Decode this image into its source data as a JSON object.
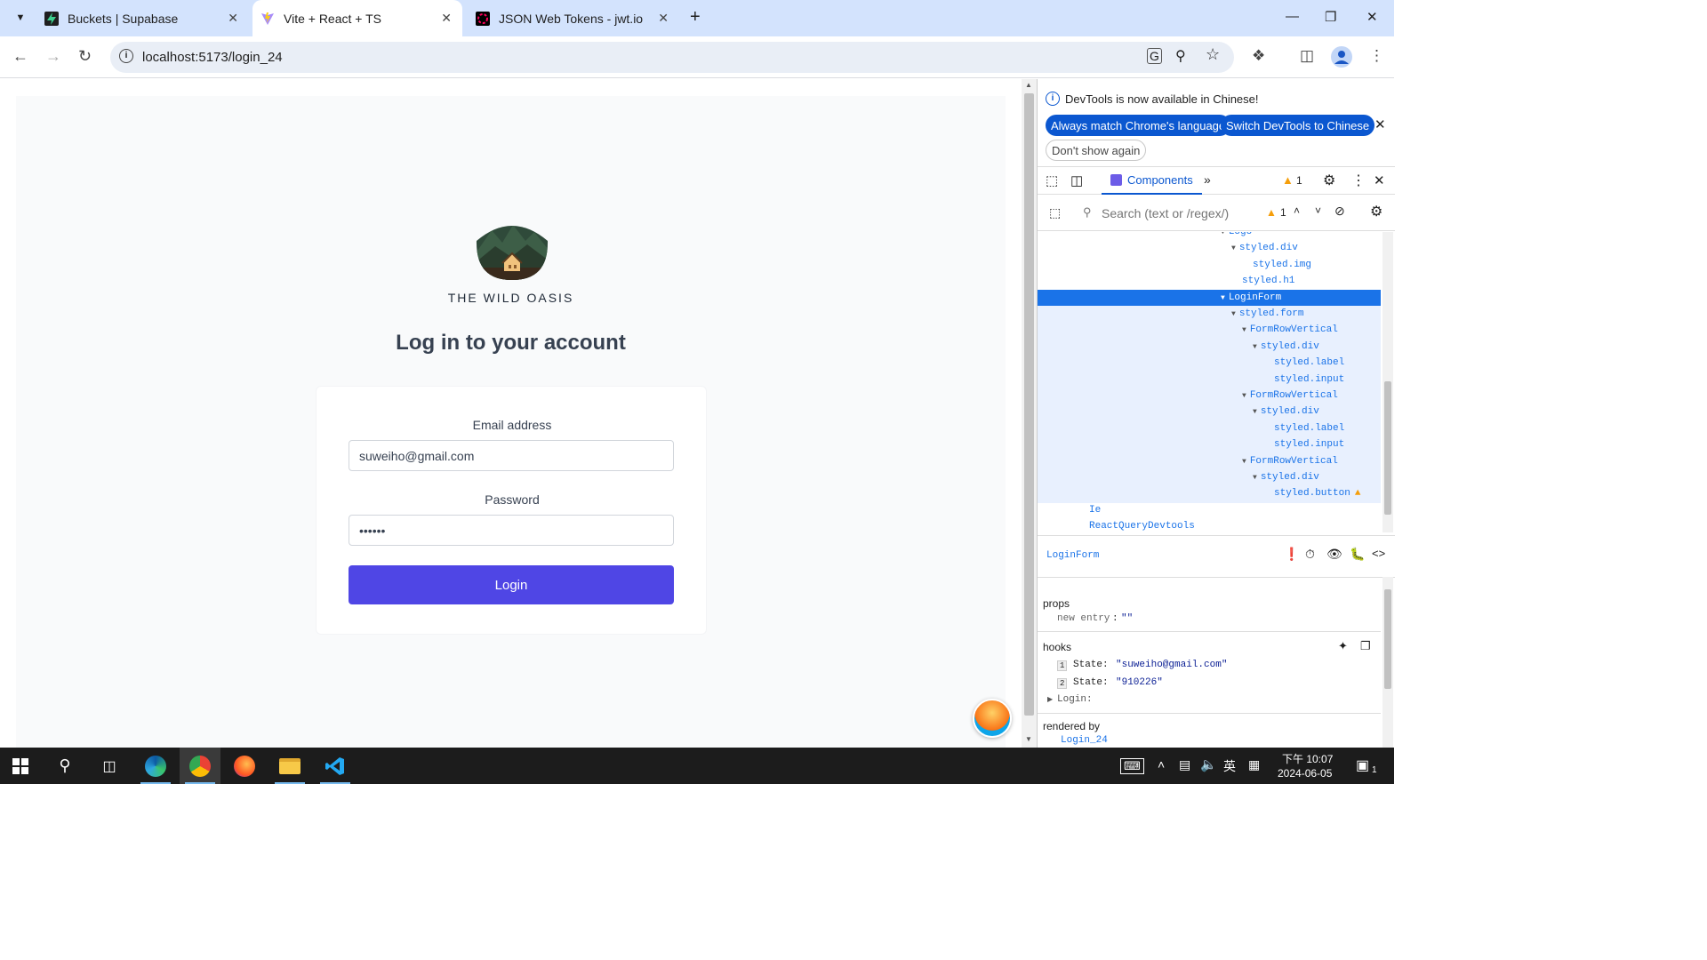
{
  "tabs": [
    {
      "title": "Buckets | Supabase",
      "favicon_color": "#3ecf8e"
    },
    {
      "title": "Vite + React + TS",
      "favicon_color": "#9f6aff"
    },
    {
      "title": "JSON Web Tokens - jwt.io",
      "favicon_color": "#d63aff"
    }
  ],
  "address": {
    "url": "localhost:5173/login_24"
  },
  "app": {
    "brand": "THE WILD OASIS",
    "heading": "Log in to your account",
    "email_label": "Email address",
    "email_value": "suweiho@gmail.com",
    "password_label": "Password",
    "password_value": "910226",
    "login_label": "Login"
  },
  "devtools": {
    "info": "DevTools is now available in Chinese!",
    "btn_match": "Always match Chrome's language",
    "btn_switch": "Switch DevTools to Chinese",
    "btn_dont": "Don't show again",
    "tab_components": "Components",
    "warn_count": "1",
    "search_placeholder": "Search (text or /regex/)",
    "search_warn_count": "1",
    "tree": [
      {
        "label": "Logo",
        "depth": 0,
        "arrow": true
      },
      {
        "label": "styled.div",
        "depth": 1,
        "arrow": true
      },
      {
        "label": "styled.img",
        "depth": 2,
        "arrow": false
      },
      {
        "label": "styled.h1",
        "depth": 1,
        "arrow": false
      },
      {
        "label": "LoginForm",
        "depth": 0,
        "arrow": true,
        "selected": true
      },
      {
        "label": "styled.form",
        "depth": 1,
        "arrow": true
      },
      {
        "label": "FormRowVertical",
        "depth": 2,
        "arrow": true
      },
      {
        "label": "styled.div",
        "depth": 3,
        "arrow": true
      },
      {
        "label": "styled.label",
        "depth": 4,
        "arrow": false
      },
      {
        "label": "styled.input",
        "depth": 4,
        "arrow": false
      },
      {
        "label": "FormRowVertical",
        "depth": 2,
        "arrow": true
      },
      {
        "label": "styled.div",
        "depth": 3,
        "arrow": true
      },
      {
        "label": "styled.label",
        "depth": 4,
        "arrow": false
      },
      {
        "label": "styled.input",
        "depth": 4,
        "arrow": false
      },
      {
        "label": "FormRowVertical",
        "depth": 2,
        "arrow": true
      },
      {
        "label": "styled.div",
        "depth": 3,
        "arrow": true
      },
      {
        "label": "styled.button",
        "depth": 4,
        "arrow": false,
        "warn": true
      },
      {
        "label": "Ie",
        "depth": -3,
        "arrow": false
      },
      {
        "label": "ReactQueryDevtools",
        "depth": -3,
        "arrow": false
      }
    ],
    "selected_component": "LoginForm",
    "props_title": "props",
    "props_new_entry": "new entry",
    "props_new_value": "\"\"",
    "hooks_title": "hooks",
    "hook1_index": "1",
    "hook1_label": "State:",
    "hook1_value": "\"suweiho@gmail.com\"",
    "hook2_index": "2",
    "hook2_label": "State:",
    "hook2_value": "\"910226\"",
    "hook3_label": "Login:",
    "rendered_by_title": "rendered by",
    "rendered_by_value": "Login_24"
  },
  "taskbar": {
    "time": "下午 10:07",
    "date": "2024-06-05",
    "ime": "英",
    "notif_count": "1"
  }
}
